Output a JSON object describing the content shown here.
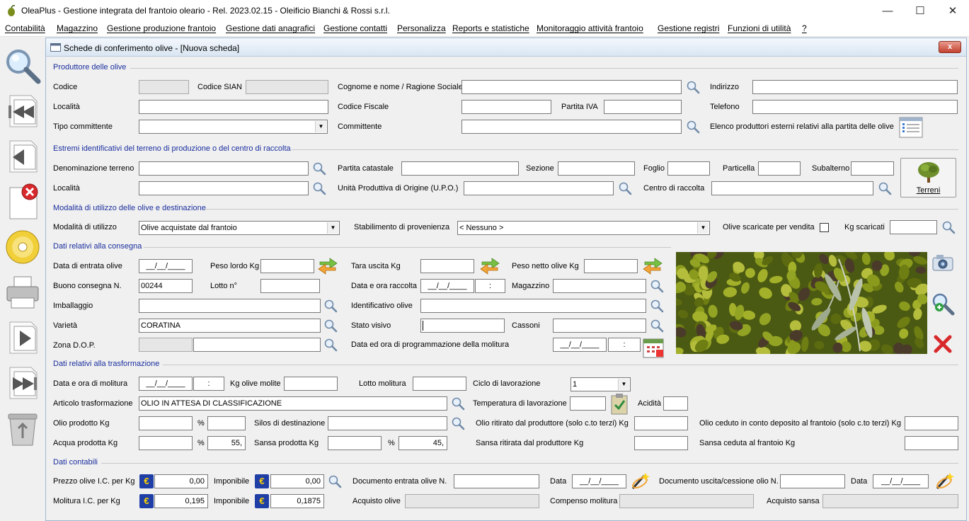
{
  "window": {
    "title": "OleaPlus - Gestione integrata del frantoio oleario - Rel. 2023.02.15 - Oleificio Bianchi & Rossi s.r.l.",
    "minimize": "—",
    "maximize": "☐",
    "close": "✕"
  },
  "menu": [
    "Contabilità",
    "Magazzino",
    "Gestione produzione frantoio",
    "Gestione dati anagrafici",
    "Gestione contatti",
    "Personalizza",
    "Reports e statistiche",
    "Monitoraggio attività frantoio",
    "Gestione registri",
    "Funzioni di utilità",
    "?"
  ],
  "child": {
    "title": "Schede di conferimento olive - [Nuova scheda]",
    "close": "x"
  },
  "sections": {
    "produttore": "Produttore delle olive",
    "terreno": "Estremi identificativi del terreno di produzione o del centro di raccolta",
    "modalita": "Modalità di utilizzo delle olive e destinazione",
    "consegna": "Dati relativi alla consegna",
    "trasformazione": "Dati relativi alla trasformazione",
    "contabili": "Dati contabili"
  },
  "labels": {
    "codice": "Codice",
    "codice_sian": "Codice SIAN",
    "cognome": "Cognome e nome / Ragione Sociale",
    "indirizzo": "Indirizzo",
    "localita": "Località",
    "codice_fiscale": "Codice Fiscale",
    "partita_iva": "Partita IVA",
    "telefono": "Telefono",
    "tipo_committente": "Tipo committente",
    "committente": "Committente",
    "elenco_produttori": "Elenco produttori esterni relativi alla partita delle olive",
    "denominazione_terreno": "Denominazione terreno",
    "partita_catastale": "Partita catastale",
    "sezione": "Sezione",
    "foglio": "Foglio",
    "particella": "Particella",
    "subalterno": "Subalterno",
    "localita2": "Località",
    "upo": "Unità Produttiva di Origine (U.P.O.)",
    "centro_raccolta": "Centro di raccolta",
    "terreni": "Terreni",
    "modalita_utilizzo": "Modalità di utilizzo",
    "stabilimento": "Stabilimento di provenienza",
    "olive_scaricate": "Olive scaricate per vendita",
    "kg_scaricati": "Kg scaricati",
    "data_entrata": "Data di entrata olive",
    "peso_lordo": "Peso lordo Kg",
    "tara_uscita": "Tara uscita Kg",
    "peso_netto": "Peso netto olive Kg",
    "buono_consegna": "Buono consegna N.",
    "lotto": "Lotto n°",
    "data_raccolta": "Data e ora raccolta",
    "magazzino": "Magazzino",
    "imballaggio": "Imballaggio",
    "identificativo": "Identificativo olive",
    "varieta": "Varietà",
    "stato_visivo": "Stato visivo",
    "cassoni": "Cassoni",
    "zona_dop": "Zona D.O.P.",
    "data_programmazione": "Data ed ora di programmazione della molitura",
    "data_molitura": "Data e ora di molitura",
    "kg_molite": "Kg olive molite",
    "lotto_molitura": "Lotto molitura",
    "ciclo": "Ciclo di lavorazione",
    "articolo": "Articolo trasformazione",
    "temperatura": "Temperatura di lavorazione",
    "acidita": "Acidità",
    "olio_prodotto": "Olio prodotto Kg",
    "pct": "%",
    "silos": "Silos di destinazione",
    "olio_ritirato": "Olio ritirato dal produttore (solo c.to terzi) Kg",
    "olio_ceduto": "Olio ceduto in conto deposito al frantoio (solo c.to terzi) Kg",
    "acqua_prodotta": "Acqua prodotta Kg",
    "sansa_prodotta": "Sansa prodotta Kg",
    "sansa_ritirata": "Sansa ritirata dal produttore Kg",
    "sansa_ceduta": "Sansa ceduta al frantoio Kg",
    "prezzo_olive": "Prezzo olive I.C. per Kg",
    "imponibile": "Imponibile",
    "doc_entrata": "Documento entrata olive N.",
    "data": "Data",
    "doc_uscita": "Documento uscita/cessione olio N.",
    "molitura_ic": "Molitura I.C. per Kg",
    "acquisto_olive": "Acquisto olive",
    "compenso_molitura": "Compenso molitura",
    "acquisto_sansa": "Acquisto sansa"
  },
  "values": {
    "date_blank": "__/__/____",
    "time_blank": ":",
    "modalita_utilizzo": "Olive acquistate dal frantoio",
    "stabilimento": "< Nessuno >",
    "buono_consegna": "00244",
    "varieta": "CORATINA",
    "ciclo": "1",
    "articolo": "OLIO IN ATTESA DI CLASSIFICAZIONE",
    "acqua_pct": "55,",
    "sansa_pct": "45,",
    "prezzo_olive": "0,00",
    "imponibile1": "0,00",
    "molitura_ic": "0,195",
    "imponibile2": "0,1875",
    "euro": "€"
  },
  "icons": [
    "search-icon",
    "rewind-icon",
    "previous-icon",
    "delete-icon",
    "save-disc-icon",
    "print-icon",
    "next-icon",
    "fast-forward-icon",
    "recycle-bin-icon",
    "camera-icon",
    "zoom-add-icon",
    "remove-x-icon",
    "calendar-icon",
    "thermometer-clipboard-icon",
    "magic-wand-icon",
    "list-document-icon",
    "tree-icon",
    "swap-arrows-icon"
  ]
}
